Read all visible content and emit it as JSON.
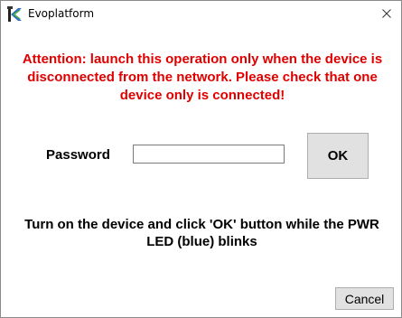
{
  "window": {
    "title": "Evoplatform",
    "app_icon": "evoplatform-logo-icon",
    "close_icon": "close-icon"
  },
  "dialog": {
    "warning_text": "Attention: launch this operation only when the device is disconnected from the network. Please check that one device only is connected!",
    "warning_color": "#e00000",
    "password_label": "Password",
    "password_value": "",
    "ok_label": "OK",
    "instruction_text": "Turn on the device and click 'OK' button while the PWR LED (blue) blinks",
    "cancel_label": "Cancel"
  }
}
